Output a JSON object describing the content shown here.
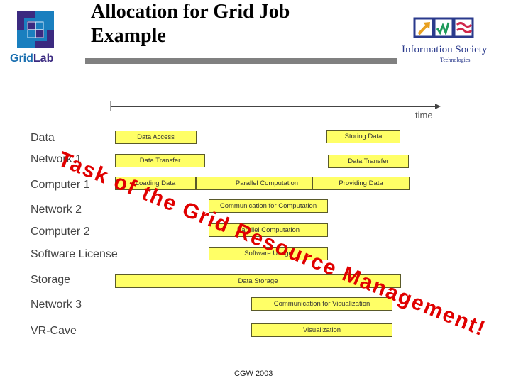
{
  "header": {
    "title_line1": "Allocation for Grid Job",
    "title_line2": "Example",
    "left_logo_text_a": "Grid",
    "left_logo_text_b": "Lab",
    "right_logo_line1": "Information Society",
    "right_logo_line2": "Technologies"
  },
  "timeline": {
    "axis_label": "time"
  },
  "rows": [
    {
      "label": "Data"
    },
    {
      "label": "Network 1"
    },
    {
      "label": "Computer 1"
    },
    {
      "label": "Network 2"
    },
    {
      "label": "Computer 2"
    },
    {
      "label": "Software License"
    },
    {
      "label": "Storage"
    },
    {
      "label": "Network 3"
    },
    {
      "label": "VR-Cave"
    }
  ],
  "tasks": [
    {
      "row": "Data",
      "label": "Data Access"
    },
    {
      "row": "Data",
      "label": "Storing Data"
    },
    {
      "row": "Network 1",
      "label": "Data Transfer"
    },
    {
      "row": "Network 1",
      "label": "Data Transfer"
    },
    {
      "row": "Computer 1",
      "label": "Loading Data"
    },
    {
      "row": "Computer 1",
      "label": "Parallel Computation"
    },
    {
      "row": "Computer 1",
      "label": "Providing Data"
    },
    {
      "row": "Network 2",
      "label": "Communication for Computation"
    },
    {
      "row": "Computer 2",
      "label": "Parallel Computation"
    },
    {
      "row": "Software License",
      "label": "Software Usage"
    },
    {
      "row": "Storage",
      "label": "Data Storage"
    },
    {
      "row": "Network 3",
      "label": "Communication for Visualization"
    },
    {
      "row": "VR-Cave",
      "label": "Visualization"
    }
  ],
  "overlay": {
    "text": "Task of the Grid Resource Management!",
    "color": "#e00000"
  },
  "footer": {
    "text": "CGW 2003"
  },
  "colors": {
    "bar_fill": "#ffff66",
    "bar_border": "#5a5a2a",
    "gridlab_dark": "#3b2a80",
    "gridlab_light": "#1a7fbf"
  }
}
